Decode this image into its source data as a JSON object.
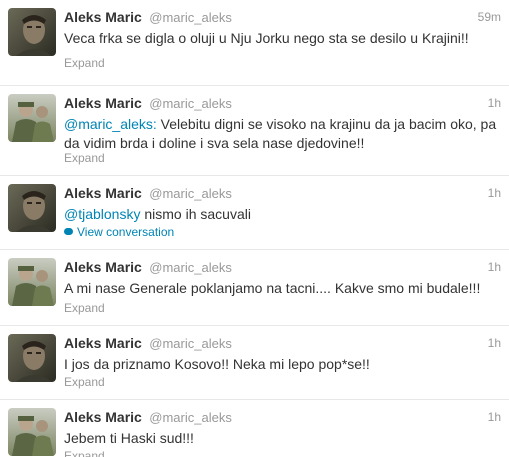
{
  "tweets": [
    {
      "fullname": "Aleks Maric",
      "username": "@maric_aleks",
      "time": "59m",
      "text": "Veca frka se digla o oluji u Nju Jorku nego sta se desilo u Krajini!!",
      "expand": "Expand"
    },
    {
      "fullname": "Aleks Maric",
      "username": "@maric_aleks",
      "time": "1h",
      "mention": "@maric_aleks:",
      "text": " Velebitu digni se visoko na krajinu da ja bacim oko, pa da vidim brda i doline i sva sela nase djedovine!!",
      "expand": "Expand"
    },
    {
      "fullname": "Aleks Maric",
      "username": "@maric_aleks",
      "time": "1h",
      "mention": "@tjablonsky",
      "text": " nismo ih sacuvali",
      "view_conversation": "View conversation"
    },
    {
      "fullname": "Aleks Maric",
      "username": "@maric_aleks",
      "time": "1h",
      "text": "A mi nase Generale poklanjamo na tacni.... Kakve smo mi budale!!!",
      "expand": "Expand"
    },
    {
      "fullname": "Aleks Maric",
      "username": "@maric_aleks",
      "time": "1h",
      "text": "I jos da priznamo Kosovo!! Neka mi lepo pop*se!!",
      "expand": "Expand"
    },
    {
      "fullname": "Aleks Maric",
      "username": "@maric_aleks",
      "time": "1h",
      "text": "Jebem ti Haski sud!!!",
      "expand": "Expand"
    }
  ]
}
